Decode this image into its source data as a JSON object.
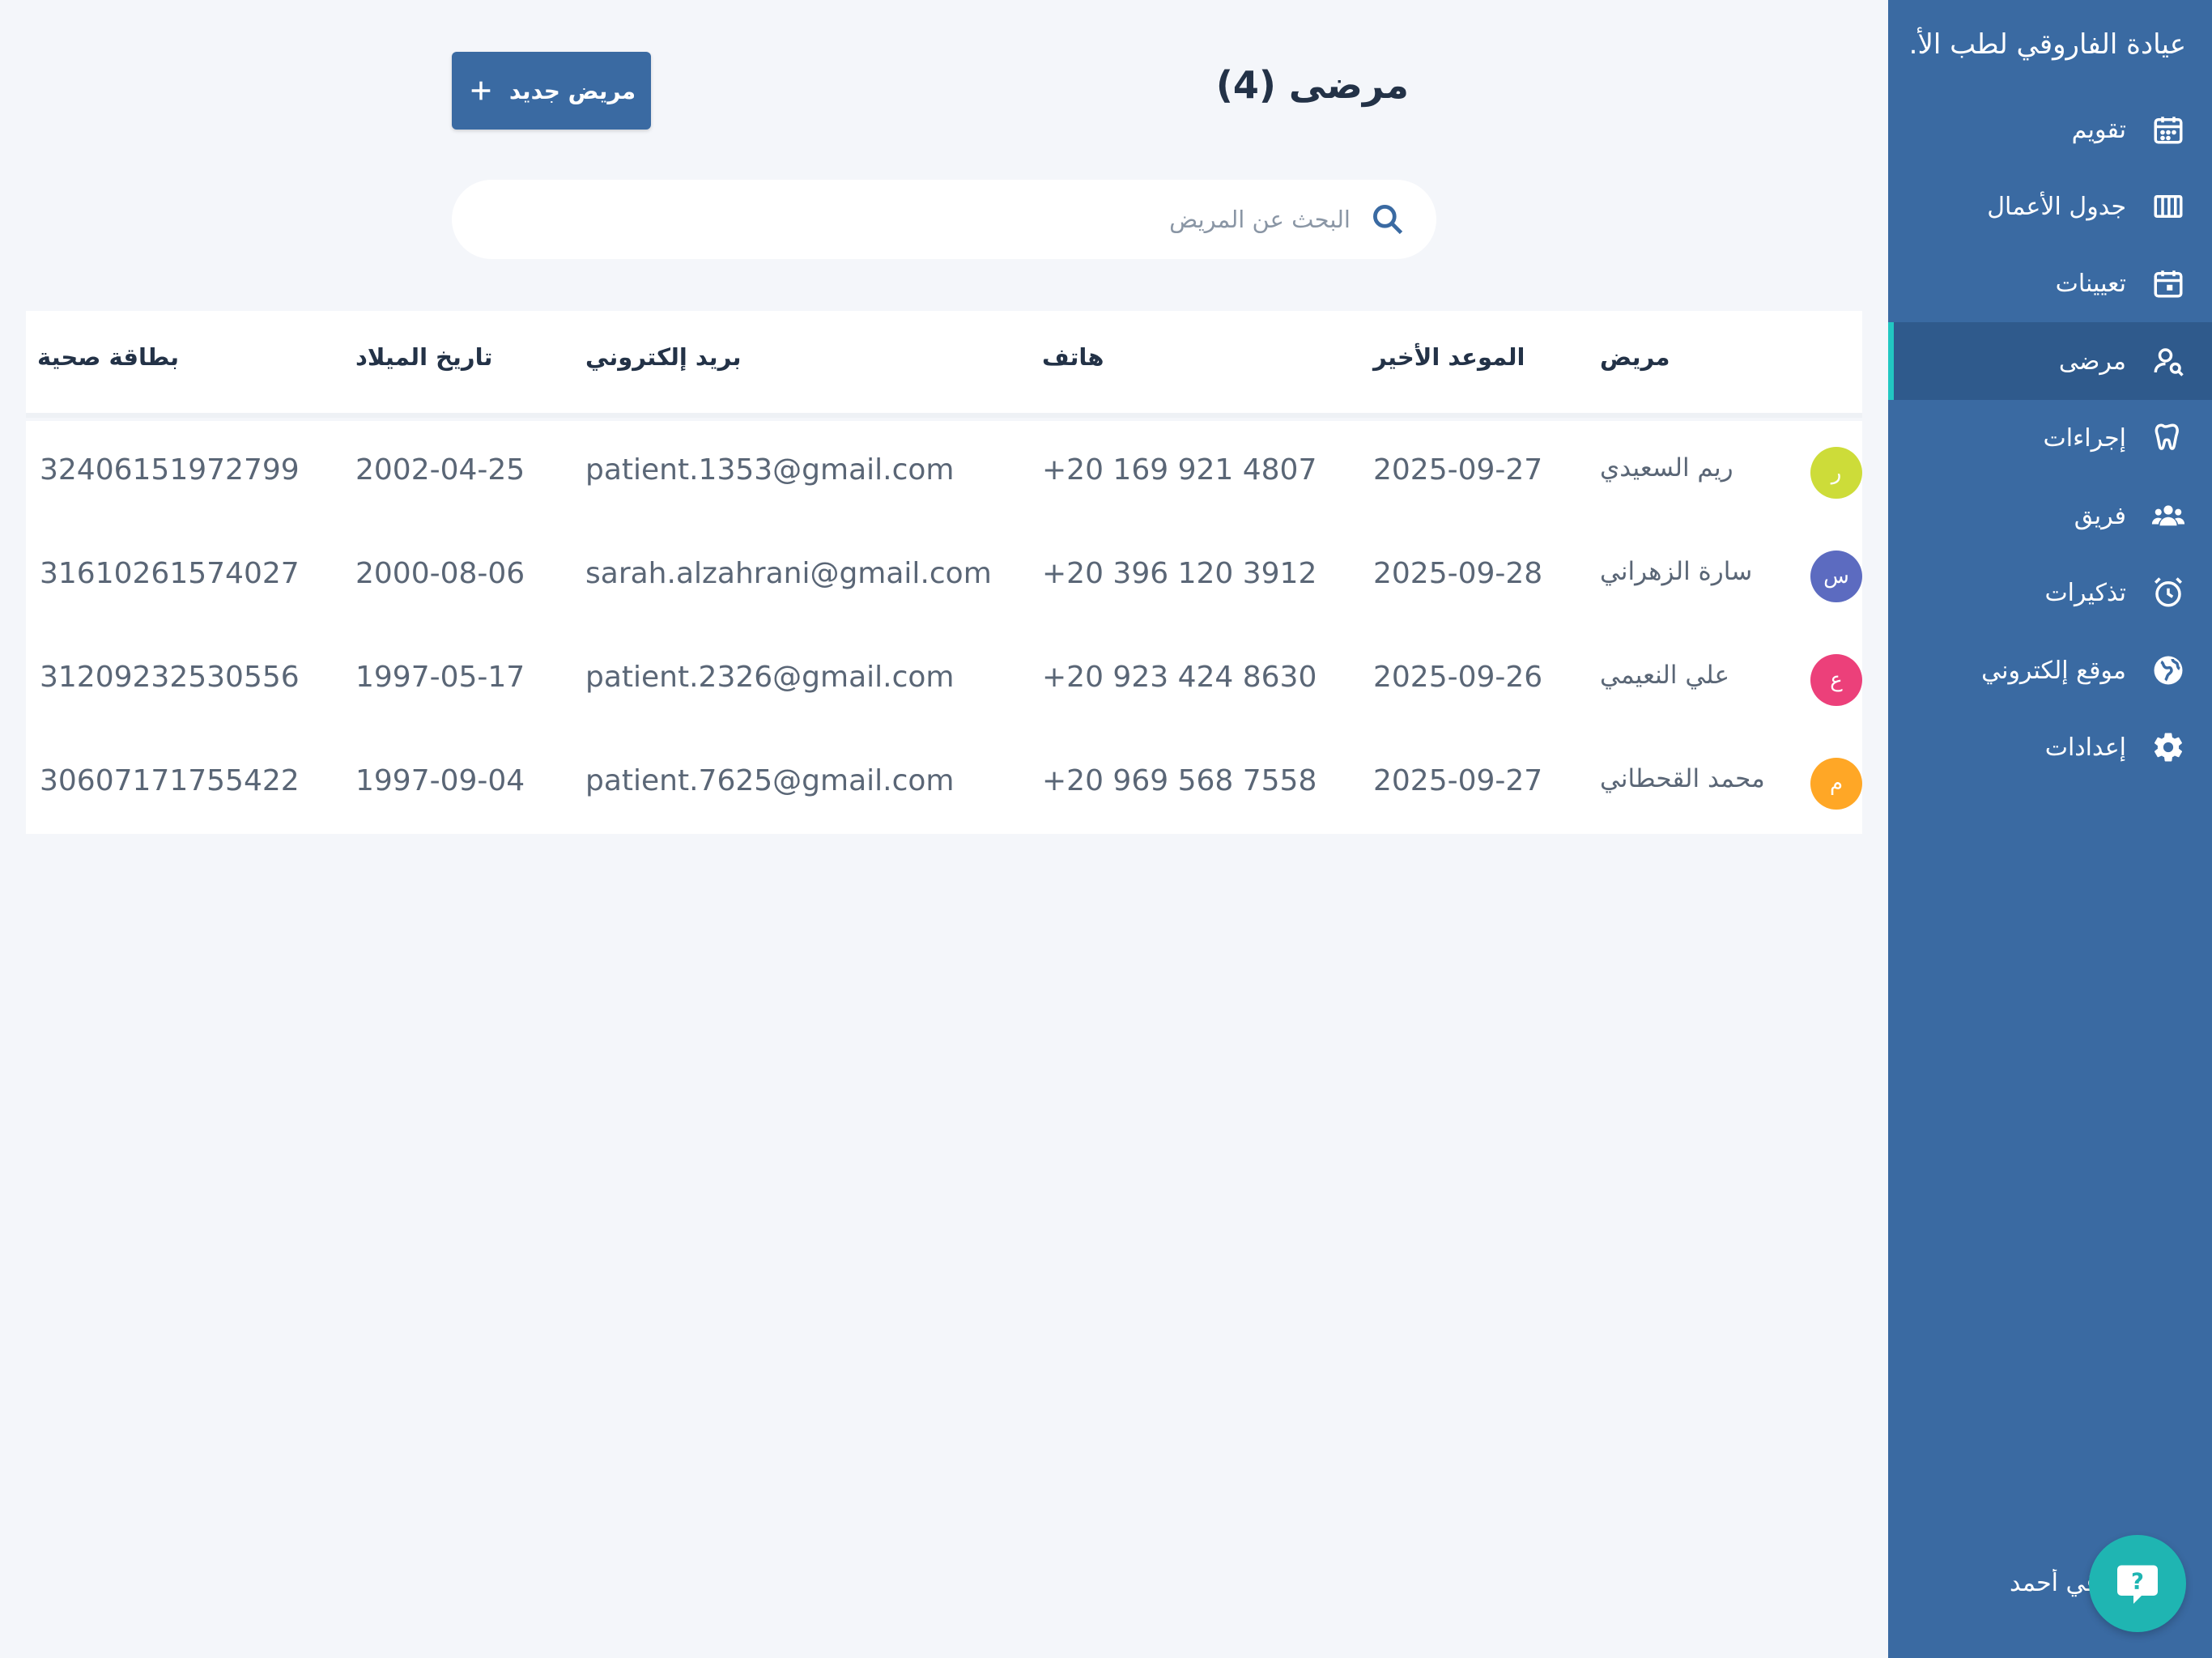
{
  "sidebar": {
    "clinic_name": "عيادة الفاروقي لطب الأ...",
    "items": [
      {
        "label": "تقويم",
        "icon": "calendar-icon"
      },
      {
        "label": "جدول الأعمال",
        "icon": "columns-icon"
      },
      {
        "label": "تعيينات",
        "icon": "calendar-event-icon"
      },
      {
        "label": "مرضى",
        "icon": "user-search-icon",
        "active": true
      },
      {
        "label": "إجراءات",
        "icon": "tooth-icon"
      },
      {
        "label": "فريق",
        "icon": "team-icon"
      },
      {
        "label": "تذكيرات",
        "icon": "alarm-icon"
      },
      {
        "label": "موقع إلكتروني",
        "icon": "globe-icon"
      },
      {
        "label": "إعدادات",
        "icon": "gear-icon"
      }
    ],
    "user_name": "روقي أحمد"
  },
  "header": {
    "title": "مرضى (4)",
    "new_button_label": "مريض جديد"
  },
  "search": {
    "placeholder": "البحث عن المريض",
    "value": ""
  },
  "table": {
    "columns": {
      "patient": "مريض",
      "last_appointment": "الموعد الأخير",
      "phone": "هاتف",
      "email": "بريد إلكتروني",
      "birth_date": "تاريخ الميلاد",
      "health_card": "بطاقة صحية"
    },
    "rows": [
      {
        "initial": "ر",
        "avatar_color": "#cddc39",
        "name": "ريم السعيدي",
        "last_appointment": "2025-09-27",
        "phone": "+20 169 921 4807",
        "email": "patient.1353@gmail.com",
        "birth_date": "2002-04-25",
        "health_card": "32406151972799"
      },
      {
        "initial": "س",
        "avatar_color": "#5c6bc0",
        "name": "سارة الزهراني",
        "last_appointment": "2025-09-28",
        "phone": "+20 396 120 3912",
        "email": "sarah.alzahrani@gmail.com",
        "birth_date": "2000-08-06",
        "health_card": "31610261574027"
      },
      {
        "initial": "ع",
        "avatar_color": "#ec407a",
        "name": "علي النعيمي",
        "last_appointment": "2025-09-26",
        "phone": "+20 923 424 8630",
        "email": "patient.2326@gmail.com",
        "birth_date": "1997-05-17",
        "health_card": "31209232530556"
      },
      {
        "initial": "م",
        "avatar_color": "#ffa726",
        "name": "محمد القحطاني",
        "last_appointment": "2025-09-27",
        "phone": "+20 969 568 7558",
        "email": "patient.7625@gmail.com",
        "birth_date": "1997-09-04",
        "health_card": "30607171755422"
      }
    ]
  },
  "colors": {
    "sidebar_bg": "#3a6aa2",
    "active_indicator": "#22c7c2",
    "help_button": "#1fb5b2"
  }
}
